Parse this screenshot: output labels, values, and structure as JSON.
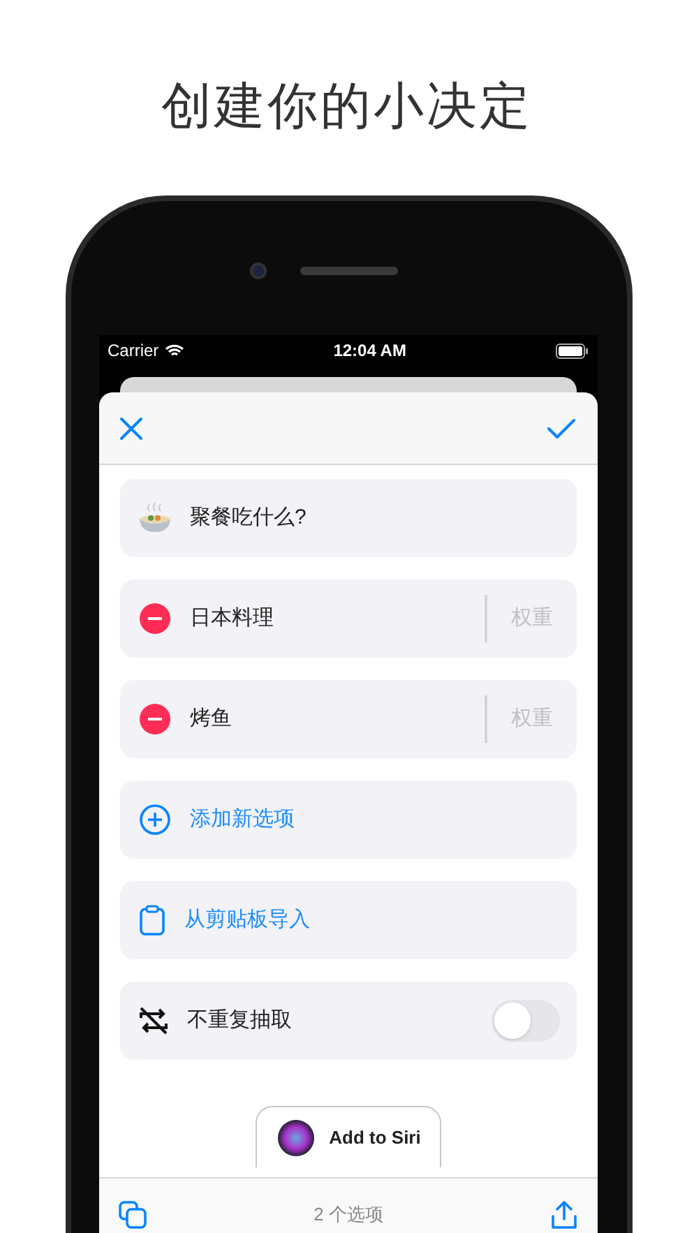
{
  "heading": "创建你的小决定",
  "status_bar": {
    "carrier": "Carrier",
    "time": "12:04 AM"
  },
  "question": {
    "text": "聚餐吃什么?"
  },
  "options": [
    {
      "name": "日本料理",
      "weight_placeholder": "权重"
    },
    {
      "name": "烤鱼",
      "weight_placeholder": "权重"
    }
  ],
  "actions": [
    {
      "kind": "add",
      "label": "添加新选项"
    },
    {
      "kind": "paste",
      "label": "从剪贴板导入"
    }
  ],
  "toggle": {
    "label": "不重复抽取",
    "on": false
  },
  "siri_button": "Add to Siri",
  "footer": {
    "count": "2 个选项"
  }
}
